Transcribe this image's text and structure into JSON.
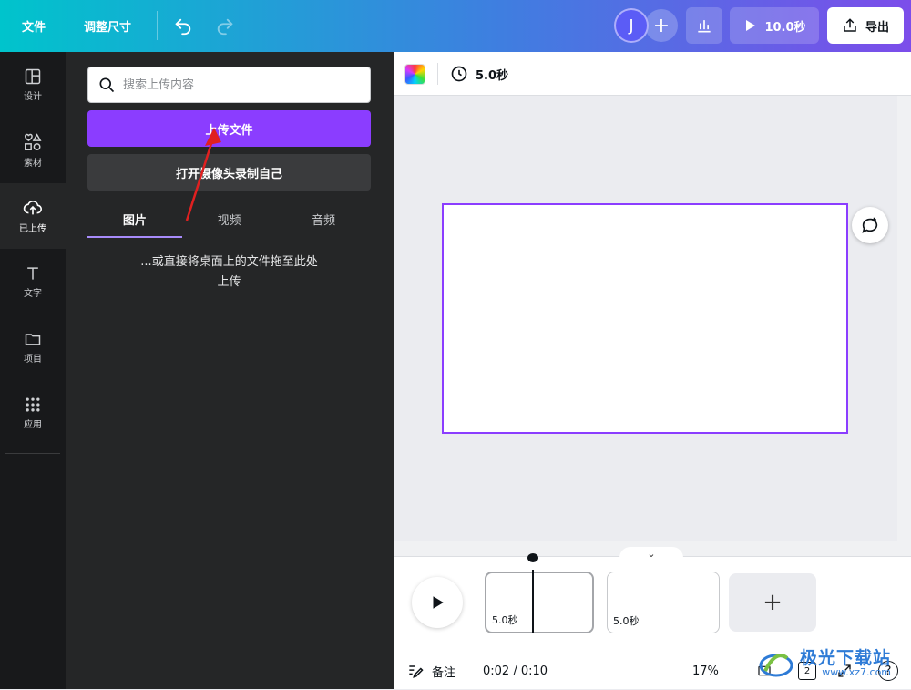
{
  "topbar": {
    "file_label": "文件",
    "resize_label": "调整尺寸",
    "avatar_initial": "J",
    "play_duration": "10.0秒",
    "export_label": "导出"
  },
  "rail": {
    "items": [
      {
        "label": "设计",
        "icon": "layout-icon"
      },
      {
        "label": "素材",
        "icon": "elements-icon"
      },
      {
        "label": "已上传",
        "icon": "upload-cloud-icon"
      },
      {
        "label": "文字",
        "icon": "text-icon"
      },
      {
        "label": "项目",
        "icon": "folder-icon"
      },
      {
        "label": "应用",
        "icon": "apps-grid-icon"
      }
    ],
    "active_index": 2
  },
  "panel": {
    "search_placeholder": "搜索上传内容",
    "upload_button": "上传文件",
    "record_button": "打开摄像头录制自己",
    "tabs": [
      {
        "label": "图片"
      },
      {
        "label": "视频"
      },
      {
        "label": "音频"
      }
    ],
    "active_tab": 0,
    "hint_line1": "...或直接将桌面上的文件拖至此处",
    "hint_line2": "上传"
  },
  "context": {
    "duration": "5.0秒"
  },
  "timeline": {
    "clips": [
      {
        "label": "5.0秒"
      },
      {
        "label": "5.0秒"
      }
    ],
    "notes_label": "备注",
    "time": "0:02 / 0:10",
    "zoom": "17%",
    "page_count": "2"
  },
  "watermark": {
    "main": "极光下载站",
    "sub": "www.xz7.com"
  },
  "colors": {
    "accent": "#8b3dff",
    "panel_bg": "#252627",
    "rail_bg": "#18191b"
  }
}
